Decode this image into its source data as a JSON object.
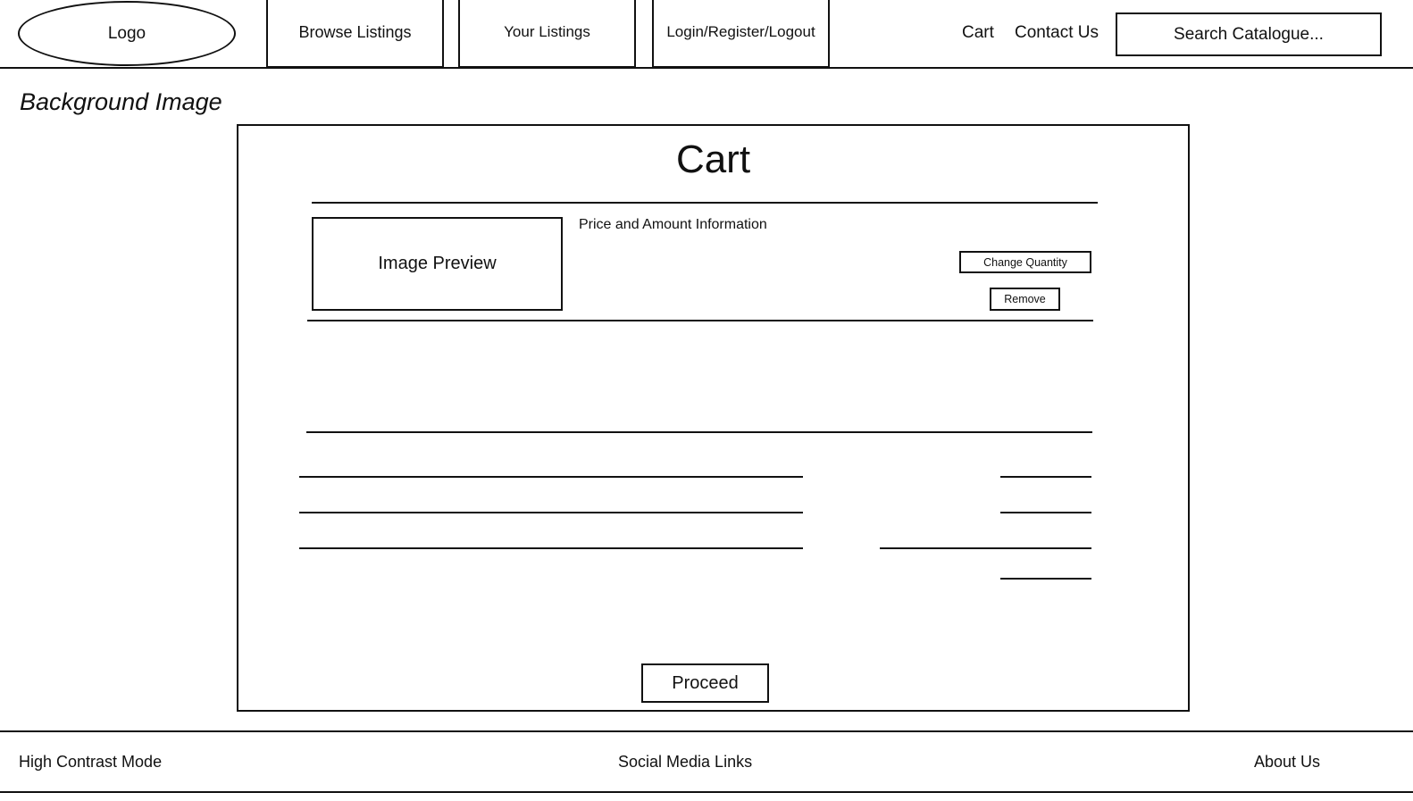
{
  "header": {
    "logo": "Logo",
    "nav": [
      "Browse Listings",
      "Your Listings",
      "Login/Register/Logout"
    ],
    "cart_link": "Cart",
    "contact_link": "Contact Us",
    "search_placeholder": "Search Catalogue..."
  },
  "background_label": "Background Image",
  "cart": {
    "title": "Cart",
    "item": {
      "image_label": "Image Preview",
      "info": "Price and Amount Information",
      "change_quantity": "Change Quantity",
      "remove": "Remove"
    },
    "proceed": "Proceed"
  },
  "footer": {
    "high_contrast": "High Contrast Mode",
    "social": "Social Media Links",
    "about": "About Us"
  }
}
